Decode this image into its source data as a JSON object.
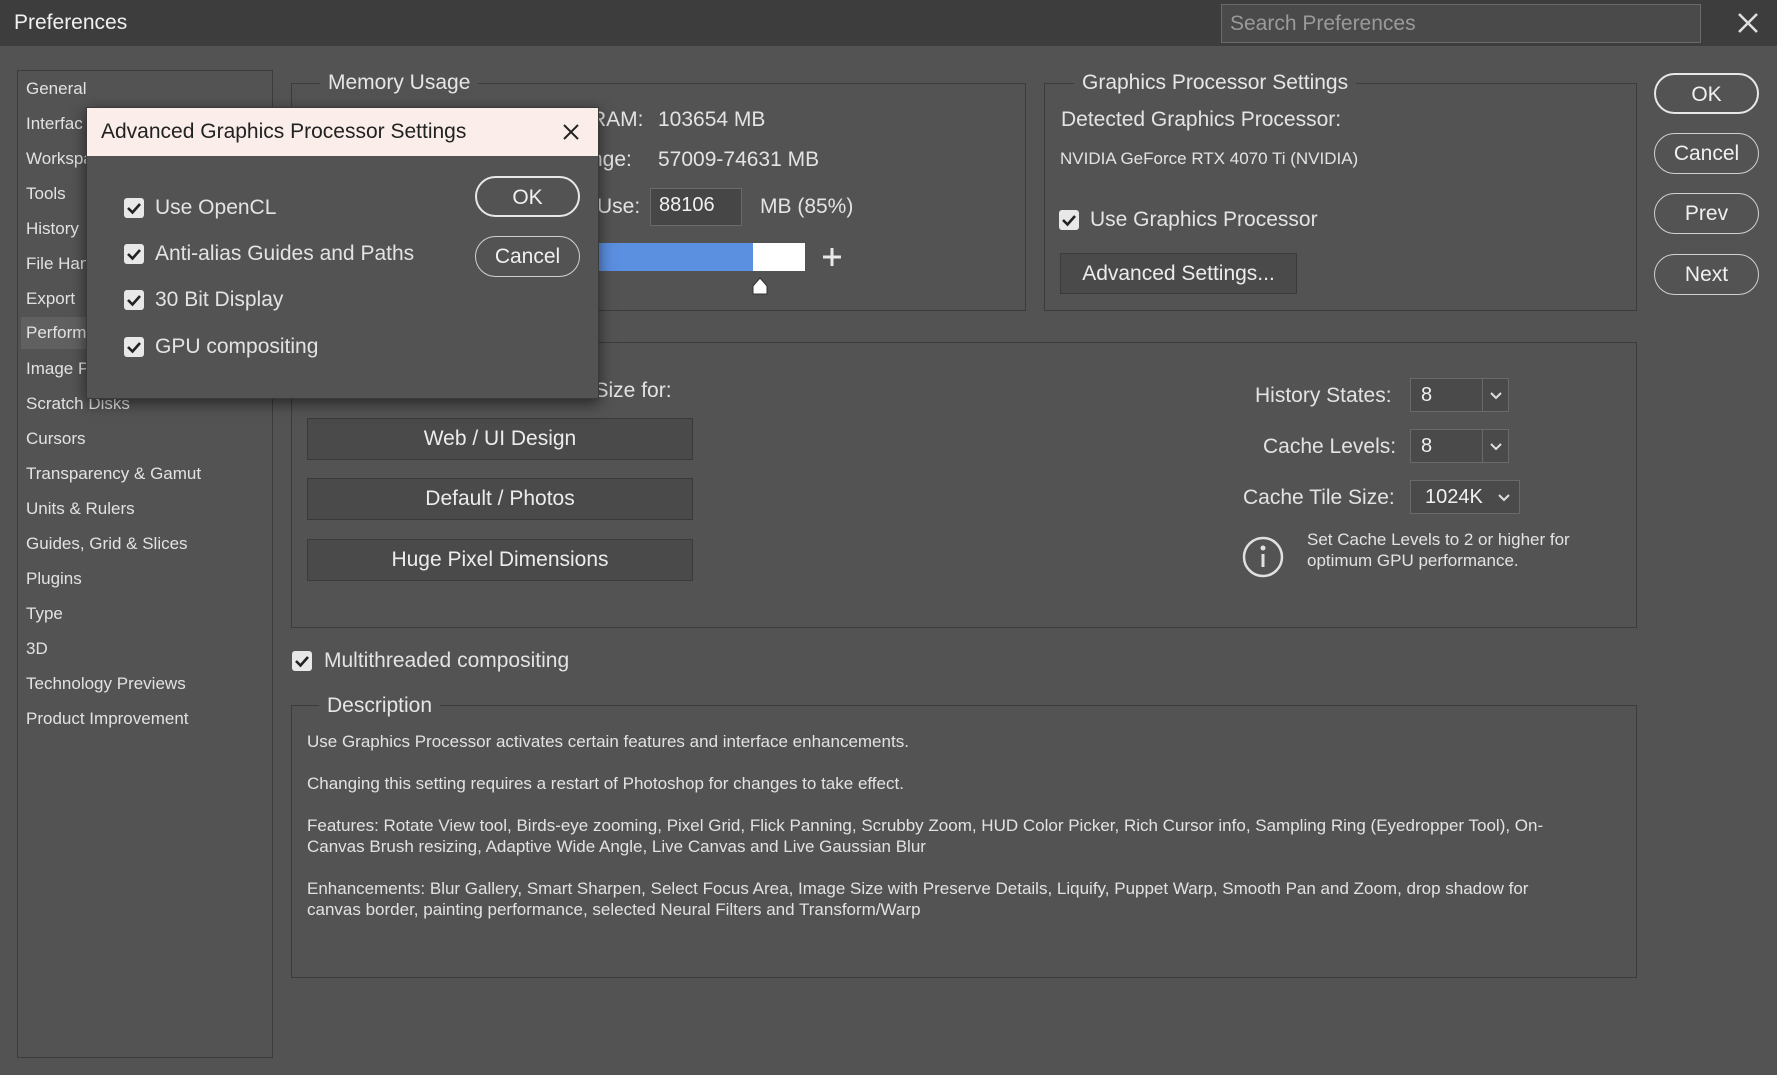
{
  "window": {
    "title": "Preferences",
    "search_placeholder": "Search Preferences",
    "close_icon": "close-icon"
  },
  "sidebar": {
    "items": [
      {
        "label": "General"
      },
      {
        "label": "Interface"
      },
      {
        "label": "Workspace"
      },
      {
        "label": "Tools"
      },
      {
        "label": "History & Content Credentials"
      },
      {
        "label": "File Handling"
      },
      {
        "label": "Export"
      },
      {
        "label": "Performance"
      },
      {
        "label": "Image Processing"
      },
      {
        "label": "Scratch Disks"
      },
      {
        "label": "Cursors"
      },
      {
        "label": "Transparency & Gamut"
      },
      {
        "label": "Units & Rulers"
      },
      {
        "label": "Guides, Grid & Slices"
      },
      {
        "label": "Plugins"
      },
      {
        "label": "Type"
      },
      {
        "label": "3D"
      },
      {
        "label": "Technology Previews"
      },
      {
        "label": "Product Improvement"
      }
    ],
    "visible_labels": [
      "General",
      "Interfac",
      "Workspa",
      "Tools",
      "History",
      "File Han",
      "Export",
      "Performa",
      "Image P",
      "Scratch Disks",
      "Cursors",
      "Transparency & Gamut",
      "Units & Rulers",
      "Guides, Grid & Slices",
      "Plugins",
      "Type",
      "3D",
      "Technology Previews",
      "Product Improvement"
    ]
  },
  "memory": {
    "legend": "Memory Usage",
    "ram_label": "RAM:",
    "ram_value": "103654 MB",
    "range_label": "nge:",
    "range_value": "57009-74631 MB",
    "use_label": "Use:",
    "use_value": "88106",
    "use_unit": "MB (85%)",
    "slider_percent": 85,
    "plus_icon": "plus-icon"
  },
  "gpu": {
    "legend": "Graphics Processor Settings",
    "detected_label": "Detected Graphics Processor:",
    "detected_value": "NVIDIA GeForce RTX 4070 Ti (NVIDIA)",
    "use_gpu_label": "Use Graphics Processor",
    "use_gpu_checked": true,
    "advanced_button": "Advanced Settings..."
  },
  "actions": {
    "ok": "OK",
    "cancel": "Cancel",
    "prev": "Prev",
    "next": "Next"
  },
  "history_cache": {
    "optimize_label": "e Size for:",
    "presets": [
      "Web / UI Design",
      "Default / Photos",
      "Huge Pixel Dimensions"
    ],
    "history_states_label": "History States:",
    "history_states_value": "8",
    "cache_levels_label": "Cache Levels:",
    "cache_levels_value": "8",
    "cache_tile_label": "Cache Tile Size:",
    "cache_tile_value": "1024K",
    "info_text_1": "Set Cache Levels to 2 or higher for",
    "info_text_2": "optimum GPU performance.",
    "info_icon": "info-icon"
  },
  "multithreaded": {
    "label": "Multithreaded compositing",
    "checked": true
  },
  "description": {
    "legend": "Description",
    "p1": "Use Graphics Processor activates certain features and interface enhancements.",
    "p2": "Changing this setting requires a restart of Photoshop for changes to take effect.",
    "p3a": "Features: Rotate View tool, Birds-eye zooming, Pixel Grid, Flick Panning, Scrubby Zoom, HUD Color Picker, Rich Cursor info, Sampling Ring (Eyedropper Tool), On-",
    "p3b": "Canvas Brush resizing, Adaptive Wide Angle, Live Canvas and Live Gaussian Blur",
    "p4a": "Enhancements: Blur Gallery, Smart Sharpen, Select Focus Area, Image Size with Preserve Details, Liquify, Puppet Warp, Smooth Pan and Zoom, drop shadow for",
    "p4b": "canvas border, painting performance, selected Neural Filters and Transform/Warp"
  },
  "modal": {
    "title": "Advanced Graphics Processor Settings",
    "options": [
      {
        "label": "Use OpenCL",
        "checked": true
      },
      {
        "label": "Anti-alias Guides and Paths",
        "checked": true
      },
      {
        "label": "30 Bit Display",
        "checked": true
      },
      {
        "label": "GPU compositing",
        "checked": true
      }
    ],
    "ok": "OK",
    "cancel": "Cancel"
  },
  "colors": {
    "background": "#535353",
    "titlebar": "#3d3d3d",
    "slider_fill": "#5b8fe0",
    "modal_title_bg": "#fbeeea"
  }
}
